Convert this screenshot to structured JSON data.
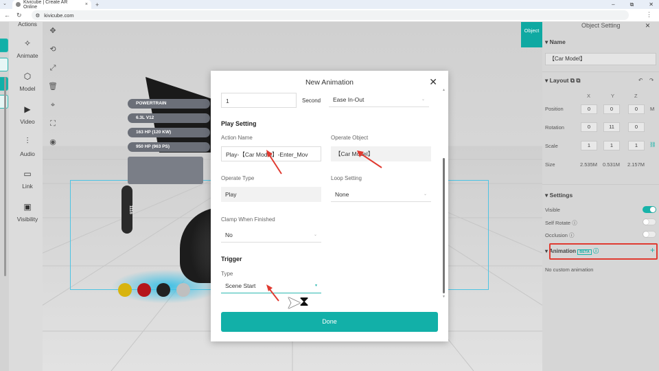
{
  "browser": {
    "tab_title": "Kivicube | Create AR Online",
    "tab_close": "×",
    "new_tab": "+",
    "url": "kivicube.com",
    "win_minimize": "–",
    "win_restore": "⧉",
    "win_close": "✕"
  },
  "leftbar": {
    "items": [
      {
        "label": "Actions"
      },
      {
        "label": "Animate"
      },
      {
        "label": "Model"
      },
      {
        "label": "Video"
      },
      {
        "label": "Audio"
      },
      {
        "label": "Link"
      },
      {
        "label": "Visibility"
      }
    ]
  },
  "viewport": {
    "powertrain_label": "POWERTRAIN",
    "specs": [
      "6.3L V12",
      "163 HP (120 KW)",
      "950 HP (963 PS)"
    ],
    "rpm_value": "1116",
    "swatch_colors": [
      "#d8b40e",
      "#b5161b",
      "#222222",
      "#bfbfbf"
    ]
  },
  "right_panel": {
    "object_tab": "Object",
    "title": "Object Setting",
    "name_section": "Name",
    "name_value": "【Car Model】",
    "layout_section": "Layout",
    "axes": [
      "X",
      "Y",
      "Z"
    ],
    "position_label": "Position",
    "position": [
      "0",
      "0",
      "0"
    ],
    "position_unit": "M",
    "rotation_label": "Rotation",
    "rotation": [
      "0",
      "11",
      "0"
    ],
    "scale_label": "Scale",
    "scale": [
      "1",
      "1",
      "1"
    ],
    "size_label": "Size",
    "size": [
      "2.535M",
      "0.531M",
      "2.157M"
    ],
    "settings_section": "Settings",
    "visible_label": "Visible",
    "self_rotate_label": "Self Rotate",
    "occlusion_label": "Occlusion",
    "animation_label": "Animation",
    "animation_badge": "BETA",
    "no_animation_text": "No custom animation",
    "accent": "#12b0a8",
    "highlight": "#e03a30"
  },
  "modal": {
    "title": "New Animation",
    "duration_value": "1",
    "duration_unit": "Second",
    "easing": "Ease In-Out",
    "play_setting_header": "Play Setting",
    "action_name_label": "Action Name",
    "action_name_value": "Play-【Car Model】-Enter_Mov",
    "operate_object_label": "Operate Object",
    "operate_object_value": "【Car Model】",
    "operate_type_label": "Operate Type",
    "operate_type_value": "Play",
    "loop_setting_label": "Loop Setting",
    "loop_setting_value": "None",
    "clamp_label": "Clamp When Finished",
    "clamp_value": "No",
    "trigger_header": "Trigger",
    "type_label": "Type",
    "type_value": "Scene Start",
    "done_button": "Done"
  }
}
